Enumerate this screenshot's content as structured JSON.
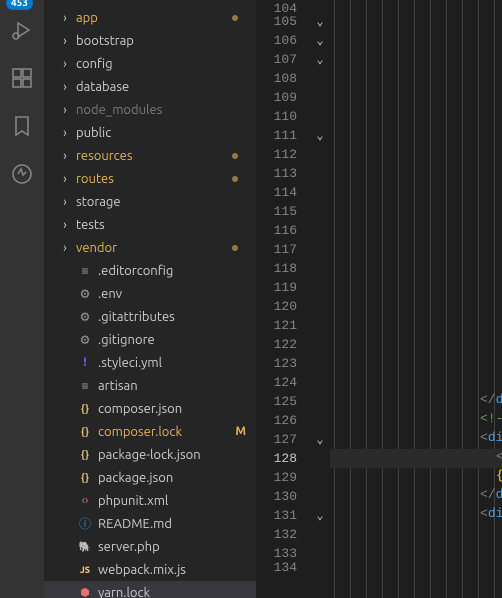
{
  "activity": {
    "badge": "453",
    "items": [
      {
        "name": "debug-icon"
      },
      {
        "name": "extensions-icon"
      },
      {
        "name": "bookmark-icon"
      },
      {
        "name": "circle-power-icon"
      }
    ]
  },
  "explorer": {
    "items": [
      {
        "type": "folder",
        "label": "app",
        "highlight": true,
        "dot": true
      },
      {
        "type": "folder",
        "label": "bootstrap"
      },
      {
        "type": "folder",
        "label": "config"
      },
      {
        "type": "folder",
        "label": "database"
      },
      {
        "type": "folder",
        "label": "node_modules",
        "muted": true
      },
      {
        "type": "folder",
        "label": "public"
      },
      {
        "type": "folder",
        "label": "resources",
        "highlight": true,
        "dot": true
      },
      {
        "type": "folder",
        "label": "routes",
        "highlight": true,
        "dot": true
      },
      {
        "type": "folder",
        "label": "storage"
      },
      {
        "type": "folder",
        "label": "tests"
      },
      {
        "type": "folder",
        "label": "vendor",
        "highlight": true,
        "dot": true
      },
      {
        "type": "file",
        "label": ".editorconfig",
        "icon": "lines"
      },
      {
        "type": "file",
        "label": ".env",
        "icon": "cog"
      },
      {
        "type": "file",
        "label": ".gitattributes",
        "icon": "cog"
      },
      {
        "type": "file",
        "label": ".gitignore",
        "icon": "cog"
      },
      {
        "type": "file",
        "label": ".styleci.yml",
        "icon": "excl"
      },
      {
        "type": "file",
        "label": "artisan",
        "icon": "lines"
      },
      {
        "type": "file",
        "label": "composer.json",
        "icon": "json"
      },
      {
        "type": "file",
        "label": "composer.lock",
        "icon": "json",
        "highlight": true,
        "gitDecor": "M"
      },
      {
        "type": "file",
        "label": "package-lock.json",
        "icon": "json"
      },
      {
        "type": "file",
        "label": "package.json",
        "icon": "json"
      },
      {
        "type": "file",
        "label": "phpunit.xml",
        "icon": "xml"
      },
      {
        "type": "file",
        "label": "README.md",
        "icon": "info"
      },
      {
        "type": "file",
        "label": "server.php",
        "icon": "php"
      },
      {
        "type": "file",
        "label": "webpack.mix.js",
        "icon": "js"
      },
      {
        "type": "file",
        "label": "yarn.lock",
        "icon": "pkg",
        "selected": true
      }
    ]
  },
  "editor": {
    "activeLine": 128,
    "lines": [
      {
        "n": 104,
        "partial": true
      },
      {
        "n": 105,
        "fold": true
      },
      {
        "n": 106,
        "fold": true
      },
      {
        "n": 107,
        "fold": true
      },
      {
        "n": 108
      },
      {
        "n": 109
      },
      {
        "n": 110
      },
      {
        "n": 111,
        "fold": true
      },
      {
        "n": 112
      },
      {
        "n": 113
      },
      {
        "n": 114
      },
      {
        "n": 115
      },
      {
        "n": 116
      },
      {
        "n": 117
      },
      {
        "n": 118
      },
      {
        "n": 119
      },
      {
        "n": 120
      },
      {
        "n": 121
      },
      {
        "n": 122
      },
      {
        "n": 123
      },
      {
        "n": 124
      },
      {
        "n": 125,
        "code": [
          {
            "t": "</",
            "c": "brk"
          },
          {
            "t": "div",
            "c": "tag"
          },
          {
            "t": ">",
            "c": "brk"
          }
        ],
        "indent": 150
      },
      {
        "n": 126,
        "code": [
          {
            "t": "<!-- e",
            "c": "comm"
          }
        ],
        "indent": 150
      },
      {
        "n": 127,
        "fold": true,
        "code": [
          {
            "t": "<",
            "c": "brk"
          },
          {
            "t": "div",
            "c": "tag"
          },
          {
            "t": ">",
            "c": "brk"
          }
        ],
        "indent": 150
      },
      {
        "n": 128,
        "code": [
          {
            "t": "<i",
            "c": "brk"
          }
        ],
        "indent": 166,
        "active": true
      },
      {
        "n": 129,
        "code": [
          {
            "t": "{",
            "c": "brace"
          }
        ],
        "indent": 166
      },
      {
        "n": 130,
        "code": [
          {
            "t": "</",
            "c": "brk"
          },
          {
            "t": "div",
            "c": "tag"
          },
          {
            "t": ">",
            "c": "brk"
          }
        ],
        "indent": 150
      },
      {
        "n": 131,
        "fold": true,
        "code": [
          {
            "t": "<",
            "c": "brk"
          },
          {
            "t": "div",
            "c": "tag"
          },
          {
            "t": ">",
            "c": "brk"
          }
        ],
        "indent": 150
      },
      {
        "n": 132
      },
      {
        "n": 133
      },
      {
        "n": 134,
        "partial": true
      }
    ],
    "guides": [
      4,
      20,
      36,
      52,
      68,
      84,
      100,
      116,
      132,
      148,
      164
    ]
  },
  "iconGlyphs": {
    "json": "{}",
    "info": "ⓘ",
    "cog": "⚙",
    "excl": "!",
    "lines": "≡",
    "xml": "‹›",
    "php": "🐘",
    "js": "JS",
    "pkg": "⬢"
  }
}
